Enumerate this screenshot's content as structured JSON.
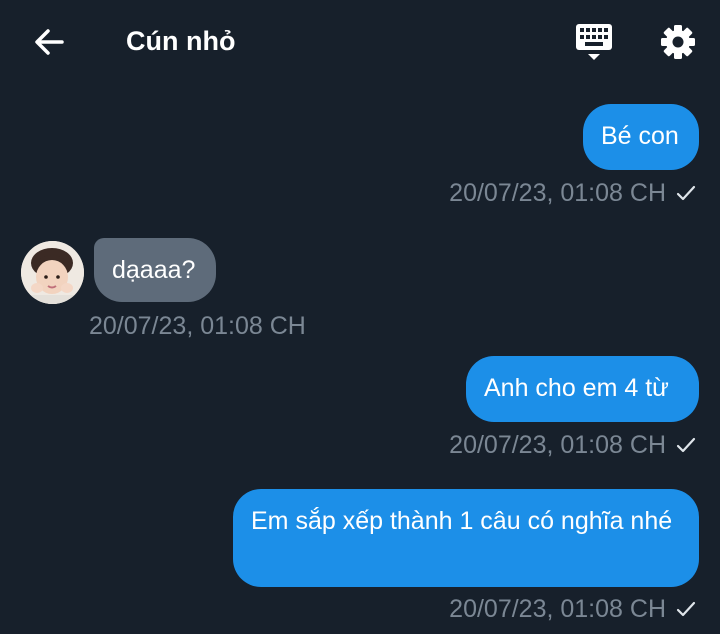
{
  "header": {
    "title": "Cún nhỏ",
    "icons": {
      "back": "arrow-left-icon",
      "keyboard": "keyboard-icon",
      "settings": "gear-icon"
    }
  },
  "messages": [
    {
      "direction": "out",
      "text": "Bé con",
      "time": "20/07/23, 01:08 CH",
      "status": "sent-check-icon"
    },
    {
      "direction": "in",
      "text": "dạaaa?",
      "time": "20/07/23, 01:08 CH"
    },
    {
      "direction": "out",
      "text": "Anh cho em 4 từ",
      "time": "20/07/23, 01:08 CH",
      "status": "sent-check-icon"
    },
    {
      "direction": "out",
      "text": "Em sắp xếp thành 1 câu có nghĩa nhé",
      "time": "20/07/23, 01:08 CH",
      "status": "sent-check-icon"
    }
  ],
  "colors": {
    "background": "#17202b",
    "outgoing": "#1c8fe8",
    "incoming": "#5e6b7a",
    "meta": "#7b8794"
  }
}
